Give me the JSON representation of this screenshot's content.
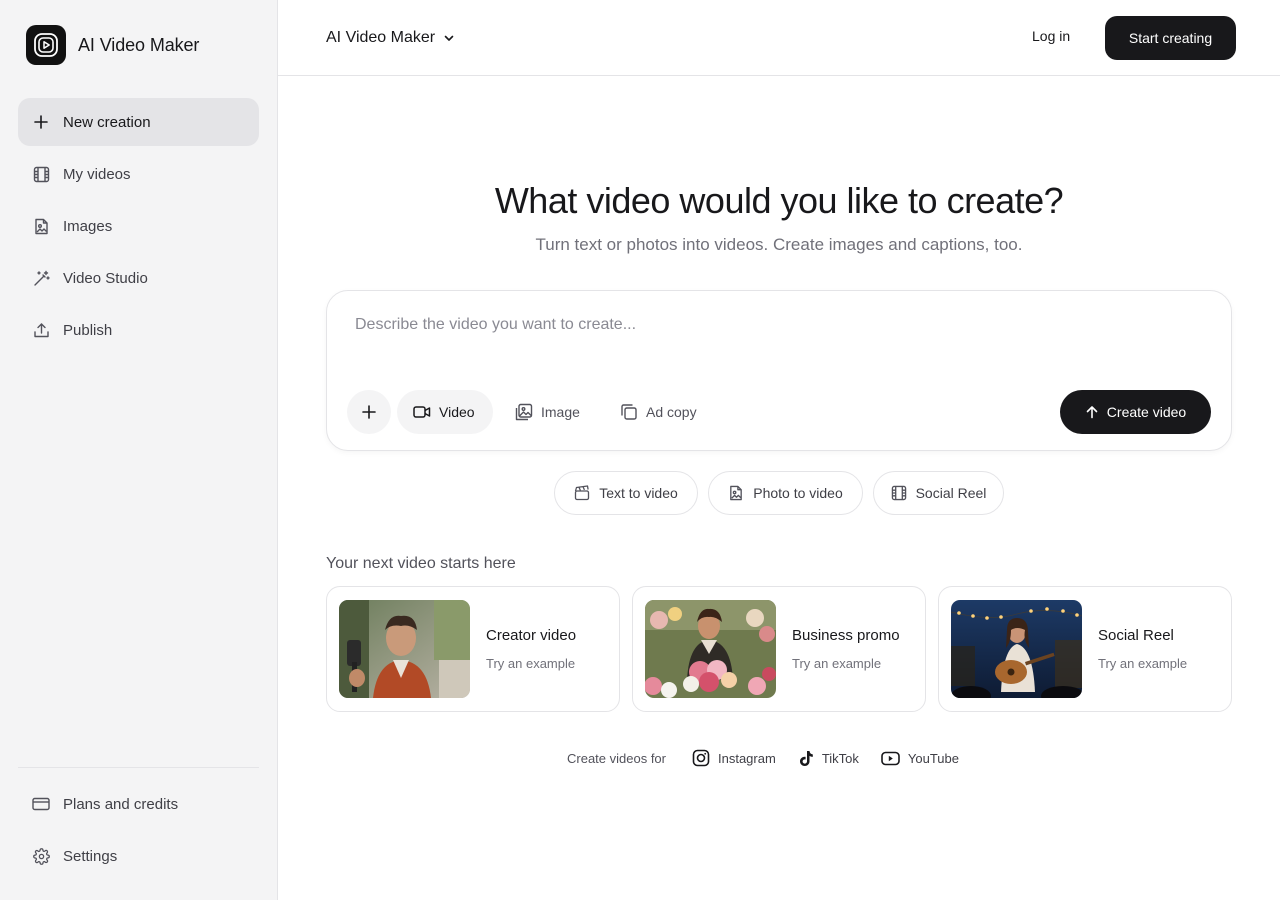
{
  "app": {
    "brand_name": "AI Video Maker"
  },
  "sidebar": {
    "items": [
      {
        "label": "New creation",
        "icon": "plus-icon"
      },
      {
        "label": "My videos",
        "icon": "film-icon"
      },
      {
        "label": "Images",
        "icon": "image-file-icon"
      },
      {
        "label": "Video Studio",
        "icon": "magic-wand-icon"
      },
      {
        "label": "Publish",
        "icon": "upload-icon"
      }
    ],
    "bottom_items": [
      {
        "label": "Plans and credits",
        "icon": "credit-card-icon"
      },
      {
        "label": "Settings",
        "icon": "gear-icon"
      }
    ]
  },
  "header": {
    "model_select": "AI Video Maker",
    "login_label": "Log in",
    "start_label": "Start creating"
  },
  "hero": {
    "title": "What video would you like to create?",
    "subtitle": "Turn text or photos into videos. Create images and captions, too."
  },
  "prompt": {
    "placeholder": "Describe the video you want to create...",
    "value": "",
    "modes": [
      {
        "label": "Video",
        "icon": "video-camera-icon",
        "active": true
      },
      {
        "label": "Image",
        "icon": "images-icon",
        "active": false
      },
      {
        "label": "Ad copy",
        "icon": "copy-icon",
        "active": false
      }
    ],
    "submit_label": "Create video"
  },
  "chips": [
    {
      "label": "Text to video",
      "icon": "clapperboard-icon"
    },
    {
      "label": "Photo to video",
      "icon": "image-file-icon"
    },
    {
      "label": "Social Reel",
      "icon": "film-icon"
    }
  ],
  "examples": {
    "heading": "Your next video starts here",
    "cards": [
      {
        "title": "Creator video",
        "subtitle": "Try an example"
      },
      {
        "title": "Business promo",
        "subtitle": "Try an example"
      },
      {
        "title": "Social Reel",
        "subtitle": "Try an example"
      }
    ]
  },
  "platforms": {
    "label": "Create videos for",
    "items": [
      {
        "label": "Instagram",
        "icon": "instagram-icon"
      },
      {
        "label": "TikTok",
        "icon": "tiktok-icon"
      },
      {
        "label": "YouTube",
        "icon": "youtube-icon"
      }
    ]
  },
  "colors": {
    "accent": "#18181b",
    "sidebar_bg": "#f4f4f5",
    "border": "#e4e4e7",
    "muted_text": "#71717a"
  }
}
